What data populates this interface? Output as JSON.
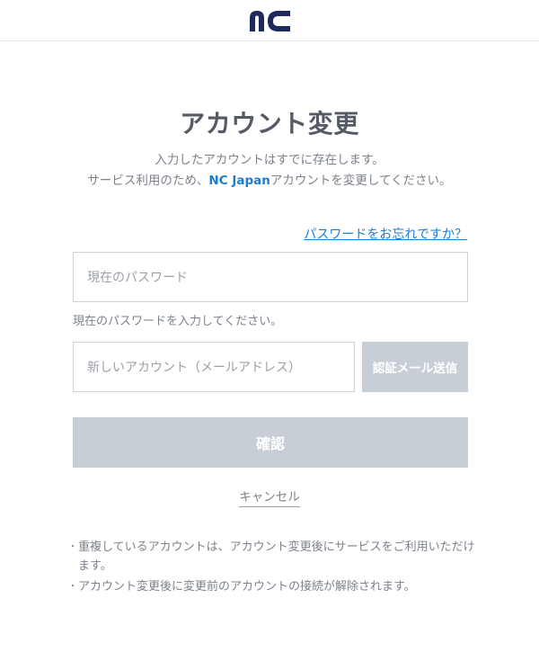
{
  "header": {
    "logo_text": "nc"
  },
  "title": "アカウント変更",
  "description": {
    "line1": "入力したアカウントはすでに存在します。",
    "line2_before": "サービス利用のため、",
    "line2_brand": "NC Japan",
    "line2_after": "アカウントを変更してください。"
  },
  "forgot_password_link": "パスワードをお忘れですか？",
  "password_field": {
    "placeholder": "現在のパスワード"
  },
  "password_hint": "現在のパスワードを入力してください。",
  "account_field": {
    "placeholder": "新しいアカウント（メールアドレス）"
  },
  "send_verification_button": "認証メール送信",
  "confirm_button": "確認",
  "cancel_link": "キャンセル",
  "notes": [
    "重複しているアカウントは、アカウント変更後にサービスをご利用いただけます。",
    "アカウント変更後に変更前のアカウントの接続が解除されます。"
  ],
  "colors": {
    "brand_navy": "#1f2a5c",
    "link_blue": "#1b7cd4",
    "disabled_button": "#c8ced6"
  }
}
